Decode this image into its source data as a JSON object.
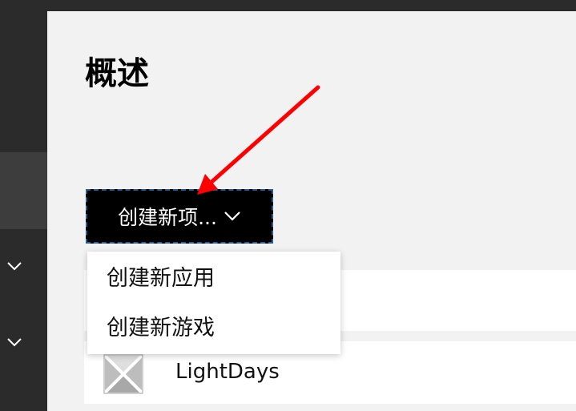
{
  "page": {
    "title": "概述"
  },
  "toolbar": {
    "create_button_label": "创建新项...",
    "create_menu_items": [
      "创建新应用",
      "创建新游戏"
    ]
  },
  "list": {
    "items": [
      {
        "name": ""
      },
      {
        "name": "LightDays",
        "icon": "lightdays-logo"
      }
    ]
  },
  "sidebar": {
    "icons": [
      "chevron-down-icon",
      "chevron-down-icon"
    ]
  },
  "annotation": {
    "arrow_color": "#ff0000"
  },
  "colors": {
    "sidebar_bg": "#2b2b2b",
    "main_bg": "#f2f2f2",
    "button_bg": "#000000",
    "button_focus_border": "#1f5f9a"
  }
}
